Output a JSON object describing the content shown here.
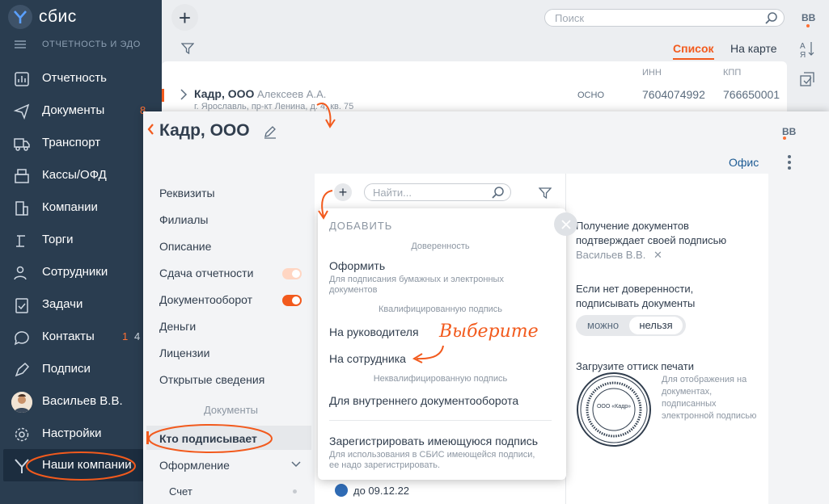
{
  "app": {
    "name": "сбис",
    "section": "ОТЧЕТНОСТЬ И ЭДО"
  },
  "sidebar": {
    "items": [
      {
        "label": "Отчетность",
        "icon": "chart-icon"
      },
      {
        "label": "Документы",
        "icon": "documents-icon",
        "badge": "8"
      },
      {
        "label": "Транспорт",
        "icon": "truck-icon"
      },
      {
        "label": "Кассы/ОФД",
        "icon": "cashbox-icon"
      },
      {
        "label": "Компании",
        "icon": "building-icon"
      },
      {
        "label": "Торги",
        "icon": "gavel-icon"
      },
      {
        "label": "Сотрудники",
        "icon": "people-icon"
      },
      {
        "label": "Задачи",
        "icon": "tasks-icon"
      },
      {
        "label": "Контакты",
        "icon": "chat-icon",
        "badge": "1",
        "badge2": "4"
      },
      {
        "label": "Подписи",
        "icon": "pen-icon"
      },
      {
        "label": "Васильев В.В.",
        "icon": "avatar"
      },
      {
        "label": "Настройки",
        "icon": "gear-icon"
      },
      {
        "label": "Наши компании",
        "icon": "logo-icon"
      }
    ]
  },
  "topbar": {
    "search_placeholder": "Поиск",
    "user_initials": "ВВ",
    "tab_list": "Список",
    "tab_map": "На карте"
  },
  "list": {
    "columns": {
      "inn": "ИНН",
      "kpp": "КПП"
    },
    "row": {
      "name": "Кадр, ООО",
      "person": "Алексеев А.А.",
      "address": "г. Ярославль, пр-кт Ленина, д. 4, кв. 75",
      "tax": "ОСНО",
      "inn": "7604074992",
      "kpp": "766650001"
    }
  },
  "card": {
    "title": "Кадр, ООО",
    "initials": "ВВ",
    "office": "Офис",
    "menu": [
      "Реквизиты",
      "Филиалы",
      "Описание",
      "Сдача отчетности",
      "Документооборот",
      "Деньги",
      "Лицензии",
      "Открытые сведения"
    ],
    "section": "Документы",
    "selected": "Кто подписывает",
    "sub1": "Оформление",
    "sub2": "Счет"
  },
  "panel": {
    "search_placeholder": "Найти...",
    "date": "до 09.12.22"
  },
  "right": {
    "text1": "Получение документов подтверждает своей подписью",
    "signer": "Васильев В.В.",
    "text2": "Если нет доверенности, подписывать документы",
    "opt_yes": "можно",
    "opt_no": "нельзя",
    "stamp_title": "Загрузите оттиск печати",
    "stamp_center": "ООО «Кадр»",
    "stamp_desc": "Для отображения на документах, подписанных электронной подписью"
  },
  "dropdown": {
    "title": "ДОБАВИТЬ",
    "group1": "Доверенность",
    "item1": "Оформить",
    "item1_sub": "Для подписания бумажных и электронных документов",
    "group2": "Квалифицированную подпись",
    "item2": "На руководителя",
    "item3": "На сотрудника",
    "group3": "Неквалифицированную подпись",
    "item4": "Для внутреннего документооборота",
    "item5": "Зарегистрировать имеющуюся подпись",
    "item5_sub": "Для использования в СБИС имеющейся подписи, ее надо зарегистрировать."
  },
  "annotation": {
    "hint": "Выберите"
  },
  "colors": {
    "sidebar": "#2a3d50",
    "accent": "#f25a1d",
    "link": "#1d5b94"
  }
}
